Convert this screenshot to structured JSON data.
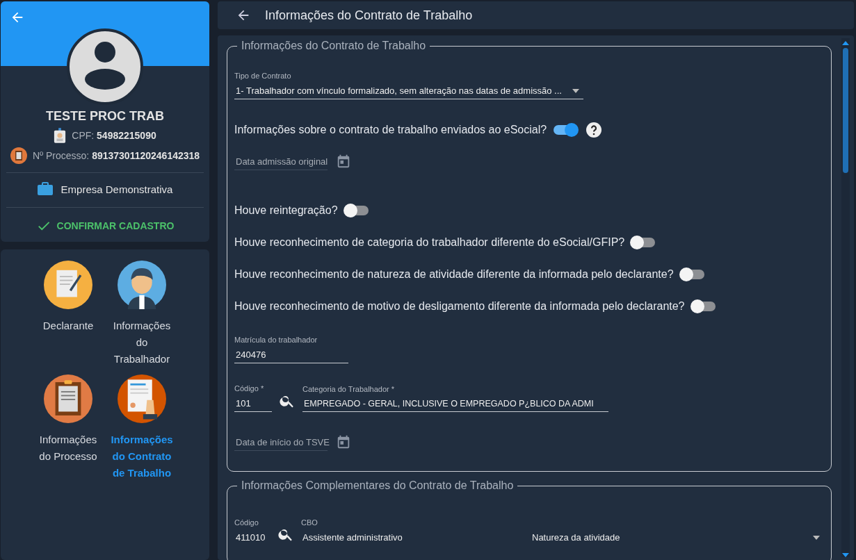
{
  "profile": {
    "name": "TESTE PROC TRAB",
    "cpf_label": "CPF:",
    "cpf": "54982215090",
    "process_label": "Nº Processo:",
    "process": "89137301120246142318",
    "company": "Empresa Demonstrativa",
    "confirm": "CONFIRMAR CADASTRO"
  },
  "nav": [
    {
      "label": "Declarante",
      "kind": "declarant",
      "selected": false
    },
    {
      "label": "Informações do Trabalhador",
      "kind": "worker",
      "selected": false
    },
    {
      "label": "Informações do Processo",
      "kind": "process",
      "selected": false
    },
    {
      "label": "Informações do Contrato de Trabalho",
      "kind": "contract",
      "selected": true
    }
  ],
  "header": {
    "title": "Informações do Contrato de Trabalho"
  },
  "contract_section": {
    "legend": "Informações do Contrato de Trabalho",
    "contract_type": {
      "label": "Tipo de Contrato",
      "value": "1- Trabalhador com vínculo formalizado, sem alteração nas datas de admissão ..."
    },
    "esocial_question": {
      "label": "Informações sobre o contrato de trabalho enviados ao eSocial?",
      "on": true
    },
    "admission_date": {
      "placeholder": "Data admissão original"
    },
    "questions": [
      {
        "label": "Houve reintegração?",
        "on": false
      },
      {
        "label": "Houve reconhecimento de categoria do trabalhador diferente do eSocial/GFIP?",
        "on": false
      },
      {
        "label": "Houve reconhecimento de natureza de atividade diferente da informada pelo declarante?",
        "on": false
      },
      {
        "label": "Houve reconhecimento de motivo de desligamento diferente da informada pelo declarante?",
        "on": false
      }
    ],
    "registration": {
      "label": "Matrícula do trabalhador",
      "value": "240476"
    },
    "category": {
      "code_label": "Código *",
      "code_value": "101",
      "label": "Categoria do Trabalhador *",
      "value": "EMPREGADO - GERAL, INCLUSIVE O EMPREGADO P¿BLICO DA ADMI"
    },
    "tsve_date": {
      "placeholder": "Data de início do TSVE"
    }
  },
  "complementary_section": {
    "legend": "Informações Complementares do Contrato de Trabalho",
    "cbo": {
      "code_label": "Código",
      "code_value": "411010",
      "label": "CBO",
      "value": "Assistente administrativo"
    },
    "activity_nature": {
      "placeholder": "Natureza da atividade"
    }
  }
}
